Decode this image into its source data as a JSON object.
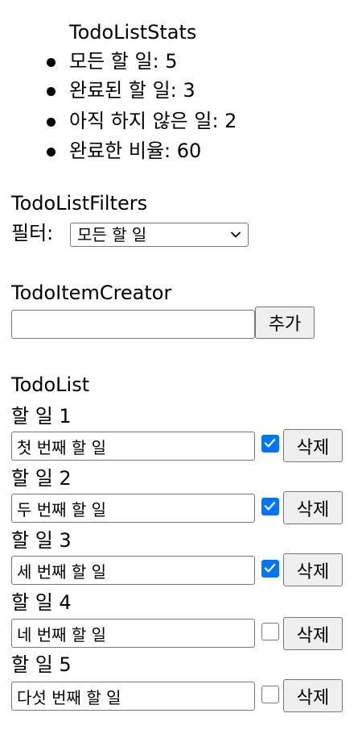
{
  "stats": {
    "title": "TodoListStats",
    "items": [
      "모든 할 일: 5",
      "완료된 할 일: 3",
      "아직 하지 않은 일: 2",
      "완료한 비율: 60"
    ]
  },
  "filters": {
    "title": "TodoListFilters",
    "label": "필터:",
    "selected": "모든 할 일"
  },
  "creator": {
    "title": "TodoItemCreator",
    "value": "",
    "add_label": "추가"
  },
  "list": {
    "title": "TodoList",
    "delete_label": "삭제",
    "items": [
      {
        "label": "할 일 1",
        "text": "첫 번째 할 일",
        "done": true
      },
      {
        "label": "할 일 2",
        "text": "두 번째 할 일",
        "done": true
      },
      {
        "label": "할 일 3",
        "text": "세 번째 할 일",
        "done": true
      },
      {
        "label": "할 일 4",
        "text": "네 번째 할 일",
        "done": false
      },
      {
        "label": "할 일 5",
        "text": "다섯 번째 할 일",
        "done": false
      }
    ]
  },
  "colors": {
    "checkbox_checked": "#0075ff"
  }
}
